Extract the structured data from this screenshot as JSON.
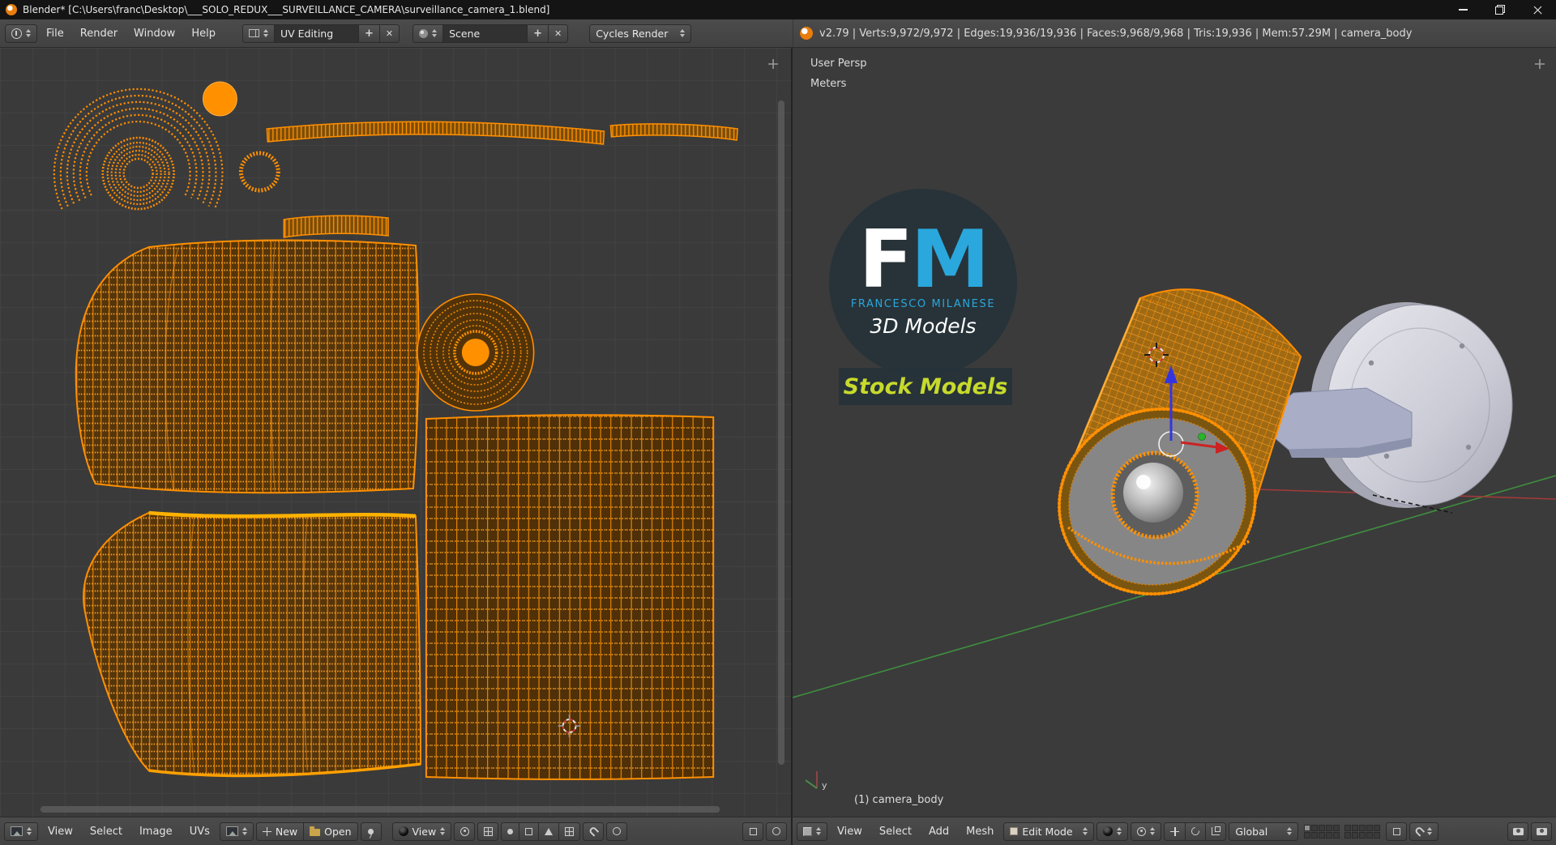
{
  "icons": {
    "plus": "+",
    "x": "✕"
  },
  "titlebar": {
    "title": "Blender* [C:\\Users\\franc\\Desktop\\___SOLO_REDUX___SURVEILLANCE_CAMERA\\surveillance_camera_1.blend]"
  },
  "header": {
    "menus": [
      "File",
      "Render",
      "Window",
      "Help"
    ],
    "layout": "UV Editing",
    "scene": "Scene",
    "engine": "Cycles Render",
    "stats": "v2.79 | Verts:9,972/9,972 | Edges:19,936/19,936 | Faces:9,968/9,968 | Tris:19,936 | Mem:57.29M | camera_body"
  },
  "uv_editor": {
    "footer": {
      "menus": [
        "View",
        "Select",
        "Image",
        "UVs"
      ],
      "new_button": "New",
      "open_button": "Open",
      "view_mode": "View"
    }
  },
  "viewport": {
    "view_label": "User Persp",
    "units_label": "Meters",
    "object_label": "(1) camera_body",
    "axis_y_label": "y",
    "watermark": {
      "initial_f": "F",
      "initial_m": "M",
      "name": "FRANCESCO MILANESE",
      "tagline": "3D Models",
      "banner": "Stock Models"
    },
    "footer": {
      "menus": [
        "View",
        "Select",
        "Add",
        "Mesh"
      ],
      "mode": "Edit Mode",
      "orientation": "Global"
    }
  },
  "colors": {
    "selection_orange": "#ff8c00",
    "accent_blue": "#2aa7dc",
    "banner_yellow": "#c7da2c",
    "header_gray": "#454545",
    "canvas_gray": "#3a3a3a"
  }
}
